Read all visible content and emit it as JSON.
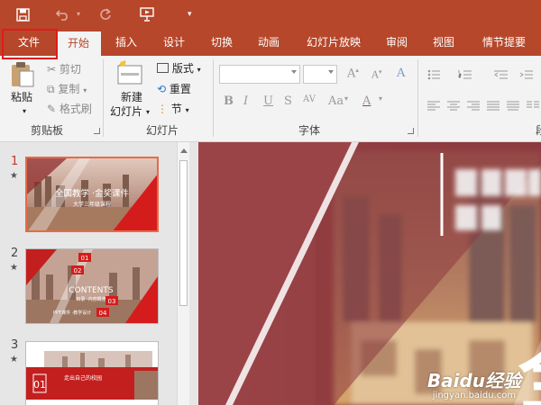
{
  "toolbar": {
    "more": "▾"
  },
  "tabs": [
    {
      "label": "文件"
    },
    {
      "label": "开始"
    },
    {
      "label": "插入"
    },
    {
      "label": "设计"
    },
    {
      "label": "切换"
    },
    {
      "label": "动画"
    },
    {
      "label": "幻灯片放映"
    },
    {
      "label": "审阅"
    },
    {
      "label": "视图"
    },
    {
      "label": "情节提要"
    }
  ],
  "ribbon": {
    "clipboard": {
      "paste": "粘贴",
      "cut": "剪切",
      "copy": "复制",
      "format_painter": "格式刷",
      "group": "剪贴板"
    },
    "slides": {
      "new_slide_line1": "新建",
      "new_slide_line2": "幻灯片",
      "layout": "版式",
      "reset": "重置",
      "section": "节",
      "group": "幻灯片"
    },
    "font": {
      "bold": "B",
      "italic": "I",
      "underline": "U",
      "strike": "S",
      "spacing": "AV",
      "grow": "A",
      "shrink": "A",
      "case": "Aa",
      "clear": "A",
      "group": "字体"
    },
    "paragraph": {
      "group_partial": "段"
    }
  },
  "slides": [
    {
      "number": "1",
      "star": "★",
      "title": "全国教学 ·金奖课件",
      "subtitle": "大学三年级课程"
    },
    {
      "number": "2",
      "star": "★",
      "tag1": "01",
      "tag2": "02",
      "heading": "CONTENTS",
      "subline": "目录 ·内容概览",
      "tag3": "03",
      "tag4": "04",
      "foot": "PPT课件 ·教学设计"
    },
    {
      "number": "3",
      "star": "★",
      "tag": "01",
      "bar_text": "走出自己的校园"
    }
  ],
  "watermark": {
    "brand": "Baidu经验",
    "url": "jingyan.baidu.com"
  },
  "slide_large": {
    "big_char": "全"
  }
}
